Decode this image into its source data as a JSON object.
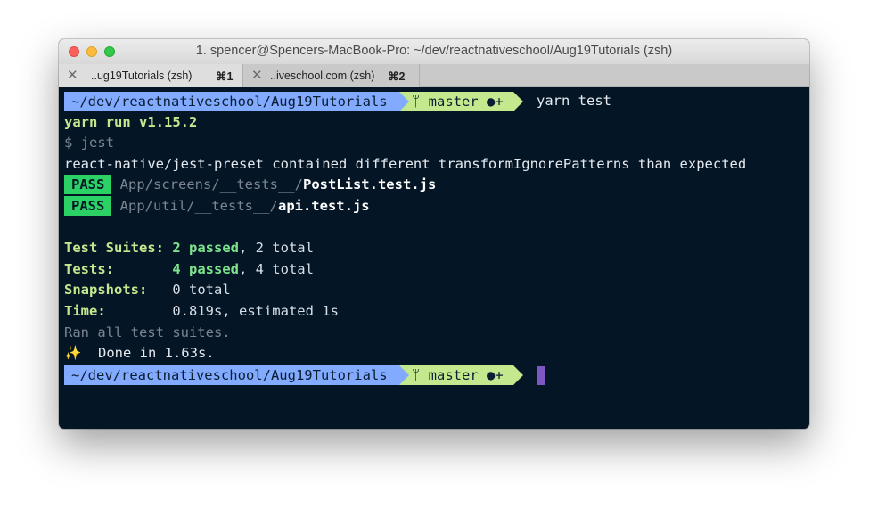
{
  "window": {
    "title": "1. spencer@Spencers-MacBook-Pro: ~/dev/reactnativeschool/Aug19Tutorials (zsh)"
  },
  "tabs": [
    {
      "close": "✕",
      "label": "..ug19Tutorials (zsh)",
      "shortcut": "⌘1"
    },
    {
      "close": "✕",
      "label": "..iveschool.com (zsh)",
      "shortcut": "⌘2"
    }
  ],
  "colors": {
    "background": "#041626",
    "path_segment": "#82aaff",
    "git_segment": "#c3e88d",
    "pass_badge": "#2bd165",
    "cursor": "#7e57c2"
  },
  "prompt1": {
    "path": "~/dev/reactnativeschool/Aug19Tutorials",
    "branch_icon": "git-branch-icon",
    "branch_glyph": "ᛘ",
    "branch": "master",
    "status": "●+",
    "command": "yarn test"
  },
  "output": {
    "yarn_version": "yarn run v1.15.2",
    "jest_cmd": "$ jest",
    "warning": "react-native/jest-preset contained different transformIgnorePatterns than expected",
    "results": [
      {
        "badge": "PASS",
        "dir": "App/screens/__tests__/",
        "file": "PostList.test.js"
      },
      {
        "badge": "PASS",
        "dir": "App/util/__tests__/",
        "file": "api.test.js"
      }
    ],
    "summary": {
      "suites_label": "Test Suites:",
      "suites_passed": "2 passed",
      "suites_total": ", 2 total",
      "tests_label": "Tests:",
      "tests_passed": "4 passed",
      "tests_total": ", 4 total",
      "snapshots_label": "Snapshots:",
      "snapshots_value": "0 total",
      "time_label": "Time:",
      "time_value": "0.819s, estimated 1s"
    },
    "ran_all": "Ran all test suites.",
    "done_icon": "✨",
    "done": "Done in 1.63s."
  },
  "prompt2": {
    "path": "~/dev/reactnativeschool/Aug19Tutorials",
    "branch_glyph": "ᛘ",
    "branch": "master",
    "status": "●+"
  }
}
